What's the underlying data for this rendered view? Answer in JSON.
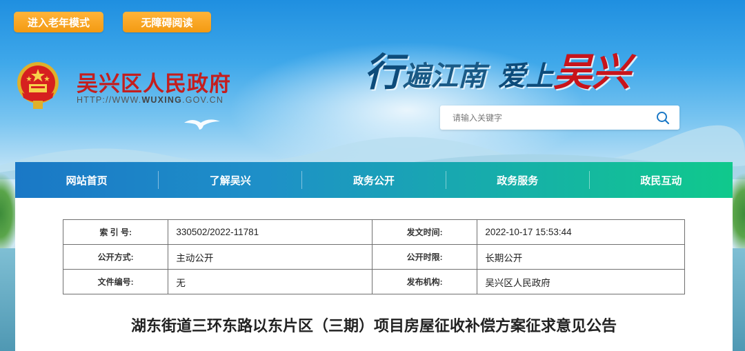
{
  "accessibility": {
    "elder_mode_label": "进入老年模式",
    "barrier_free_label": "无障碍阅读"
  },
  "header": {
    "site_title": "吴兴区人民政府",
    "site_url_prefix": "HTTP://WWW.",
    "site_url_domain": "WUXING",
    "site_url_suffix": ".GOV.CN",
    "slogan": {
      "part1": "行",
      "part2": "遍江南",
      "part3": "爱上",
      "part4": "吴兴"
    }
  },
  "search": {
    "placeholder": "请输入关键字",
    "icon": "search-icon"
  },
  "nav": {
    "items": [
      {
        "label": "网站首页"
      },
      {
        "label": "了解吴兴"
      },
      {
        "label": "政务公开"
      },
      {
        "label": "政务服务"
      },
      {
        "label": "政民互动"
      }
    ]
  },
  "meta": {
    "rows": [
      {
        "label1": "索 引 号:",
        "value1": "330502/2022-11781",
        "label2": "发文时间:",
        "value2": "2022-10-17 15:53:44"
      },
      {
        "label1": "公开方式:",
        "value1": "主动公开",
        "label2": "公开时限:",
        "value2": "长期公开"
      },
      {
        "label1": "文件编号:",
        "value1": "无",
        "label2": "发布机构:",
        "value2": "吴兴区人民政府"
      }
    ]
  },
  "article": {
    "title": "湖东街道三环东路以东片区（三期）项目房屋征收补偿方案征求意见公告"
  },
  "colors": {
    "accent_orange": "#f39a12",
    "title_red": "#c41e1e",
    "nav_start": "#1a78c6",
    "nav_end": "#10c98c"
  }
}
